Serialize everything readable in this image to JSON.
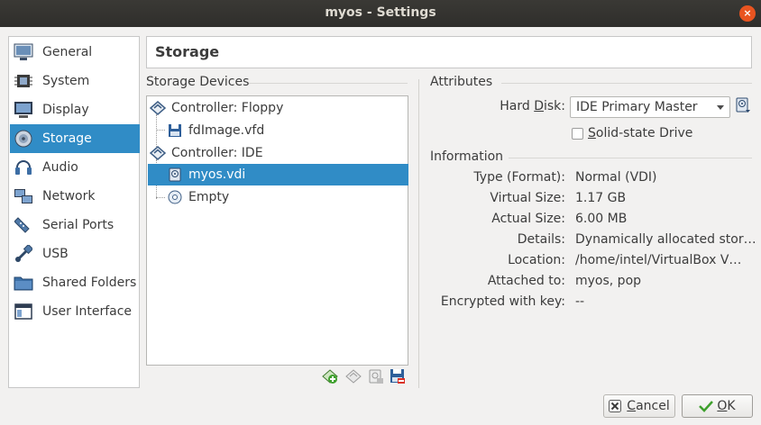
{
  "window": {
    "title": "myos - Settings",
    "close_glyph": "×"
  },
  "nav": {
    "items": [
      {
        "label": "General",
        "icon": "general-icon"
      },
      {
        "label": "System",
        "icon": "system-icon"
      },
      {
        "label": "Display",
        "icon": "display-icon"
      },
      {
        "label": "Storage",
        "icon": "storage-icon",
        "active": true
      },
      {
        "label": "Audio",
        "icon": "audio-icon"
      },
      {
        "label": "Network",
        "icon": "network-icon"
      },
      {
        "label": "Serial Ports",
        "icon": "serial-ports-icon"
      },
      {
        "label": "USB",
        "icon": "usb-icon"
      },
      {
        "label": "Shared Folders",
        "icon": "shared-folders-icon"
      },
      {
        "label": "User Interface",
        "icon": "user-interface-icon"
      }
    ]
  },
  "page": {
    "title": "Storage"
  },
  "storage": {
    "section_title": "Storage Devices",
    "tree": [
      {
        "label": "Controller: Floppy",
        "kind": "controller"
      },
      {
        "label": "fdImage.vfd",
        "kind": "floppy"
      },
      {
        "label": "Controller: IDE",
        "kind": "controller"
      },
      {
        "label": "myos.vdi",
        "kind": "disk",
        "selected": true
      },
      {
        "label": "Empty",
        "kind": "optical"
      }
    ]
  },
  "attributes": {
    "section_title": "Attributes",
    "hard_disk_label_pre": "Hard ",
    "hard_disk_label_mnemonic": "D",
    "hard_disk_label_post": "isk:",
    "hard_disk_value": "IDE Primary Master",
    "ssd_label_mnemonic": "S",
    "ssd_label_rest": "olid-state Drive",
    "ssd_checked": false
  },
  "information": {
    "section_title": "Information",
    "rows": [
      {
        "label": "Type (Format):",
        "value": "Normal (VDI)"
      },
      {
        "label": "Virtual Size:",
        "value": "1.17 GB"
      },
      {
        "label": "Actual Size:",
        "value": "6.00 MB"
      },
      {
        "label": "Details:",
        "value": "Dynamically allocated stor…"
      },
      {
        "label": "Location:",
        "value": "/home/intel/VirtualBox V…"
      },
      {
        "label": "Attached to:",
        "value": "myos, pop"
      },
      {
        "label": "Encrypted with key:",
        "value": "--"
      }
    ]
  },
  "buttons": {
    "cancel_mnemonic": "C",
    "cancel_rest": "ancel",
    "ok_mnemonic": "O",
    "ok_rest": "K"
  },
  "colors": {
    "selection": "#308cc6",
    "titlebar": "#2f2e2b",
    "close": "#e95420"
  }
}
